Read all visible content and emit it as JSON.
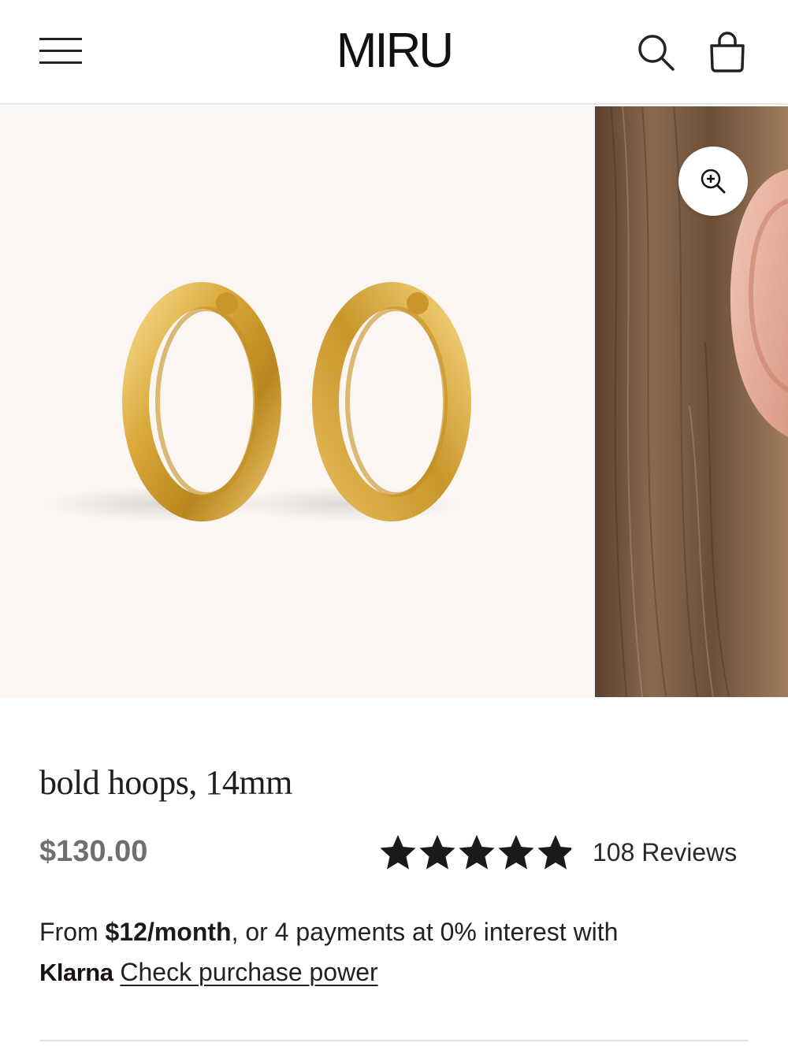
{
  "header": {
    "logo": "MIRU",
    "menu_icon": "hamburger-menu-icon",
    "search_icon": "search-icon",
    "cart_icon": "shopping-bag-icon"
  },
  "gallery": {
    "zoom_icon": "zoom-in-icon",
    "background": "#fbf6f1"
  },
  "product": {
    "title": "bold hoops, 14mm",
    "price": "$130.00",
    "rating": 4.9,
    "reviews_label": "108 Reviews"
  },
  "klarna": {
    "from_text": "From ",
    "monthly": "$12/month",
    "rest_text": ", or 4 payments at 0% interest with",
    "brand": "Klarna",
    "link_label": "Check purchase power"
  },
  "colors": {
    "gold": "#d9a93a",
    "text": "#1f1f1f",
    "price": "#6f6f6f"
  }
}
